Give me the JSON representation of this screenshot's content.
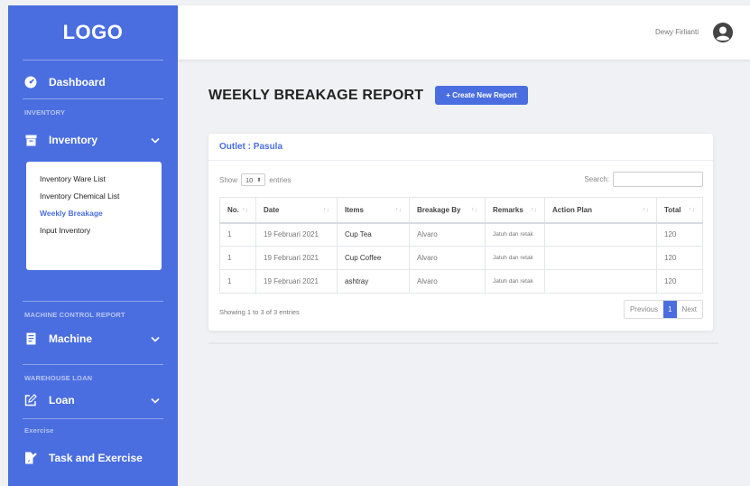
{
  "app": {
    "logo": "LOGO"
  },
  "user": {
    "name": "Dewy Firlianti"
  },
  "sidebar": {
    "dashboard": "Dashboard",
    "inventory_section": "INVENTORY",
    "inventory": "Inventory",
    "inventory_sub": [
      "Inventory Ware List",
      "Inventory Chemical List",
      "Weekly Breakage",
      "Input Inventory"
    ],
    "machine_section": "MACHINE CONTROL REPORT",
    "machine": "Machine",
    "warehouse_section": "WAREHOUSE LOAN",
    "loan": "Loan",
    "exercise_section": "Exercise",
    "task": "Task and Exercise"
  },
  "page": {
    "title": "WEEKLY BREAKAGE REPORT",
    "create_button": "+ Create New Report",
    "outlet": "Outlet : Pasula"
  },
  "table_controls": {
    "show_label": "Show",
    "show_value": "10",
    "entries_label": "entries",
    "search_label": "Search:"
  },
  "table": {
    "headers": [
      "No.",
      "Date",
      "Items",
      "Breakage By",
      "Remarks",
      "Action Plan",
      "Total"
    ],
    "rows": [
      [
        "1",
        "19 Februari 2021",
        "Cup Tea",
        "Alvaro",
        "Jatuh dan retak",
        "",
        "120"
      ],
      [
        "1",
        "19 Februari 2021",
        "Cup Coffee",
        "Alvaro",
        "Jatuh dan retak",
        "",
        "120"
      ],
      [
        "1",
        "19 Februari 2021",
        "ashtray",
        "Alvaro",
        "Jatuh dan retak",
        "",
        "120"
      ]
    ]
  },
  "footer": {
    "info": "Showing 1 to 3 of 3 entries",
    "previous": "Previous",
    "page": "1",
    "next": "Next"
  },
  "colors": {
    "accent": "#4a6ee0",
    "background": "#f0f1f4"
  }
}
